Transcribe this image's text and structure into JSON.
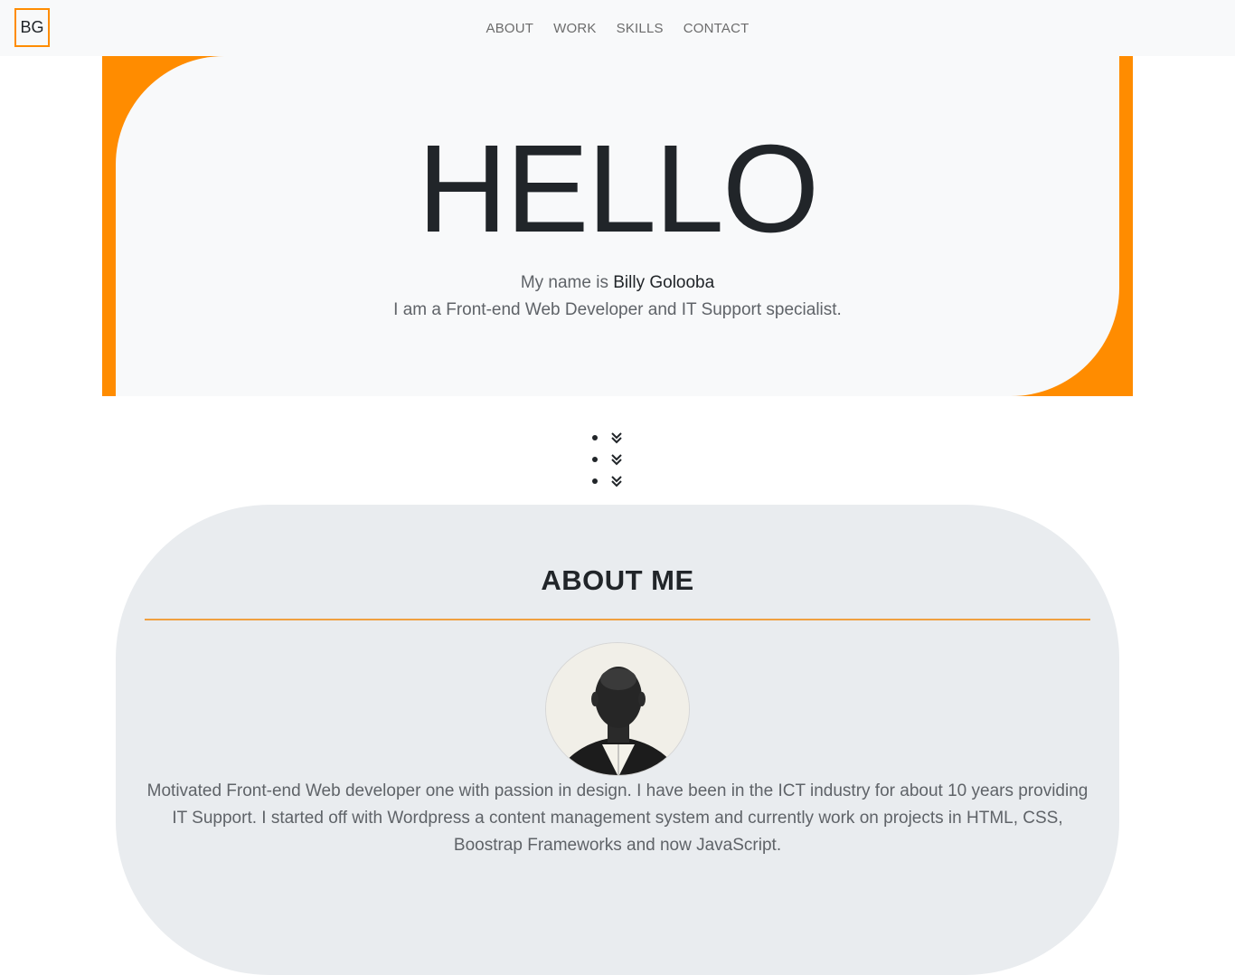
{
  "navbar": {
    "brand": "BG",
    "links": [
      "ABOUT",
      "WORK",
      "SKILLS",
      "CONTACT"
    ]
  },
  "hero": {
    "title": "HELLO",
    "intro_prefix": "My name is",
    "name": "Billy Golooba",
    "tagline": "I am a Front-end Web Developer and IT Support specialist."
  },
  "scroll_indicator": {
    "icon": "chevron-double-down-icon",
    "count": 3
  },
  "about": {
    "title": "ABOUT ME",
    "avatar": "profile-photo",
    "text": "Motivated Front-end Web developer one with passion in design. I have been in the ICT industry for about 10 years providing IT Support. I started off with Wordpress a content management system and currently work on projects in HTML, CSS, Boostrap Frameworks and now JavaScript."
  },
  "colors": {
    "accent": "#ff8c00",
    "nav_bg": "#f8f9fa",
    "about_bg": "#e9ecef",
    "text_dark": "#212529",
    "text_muted": "#5f6368"
  }
}
